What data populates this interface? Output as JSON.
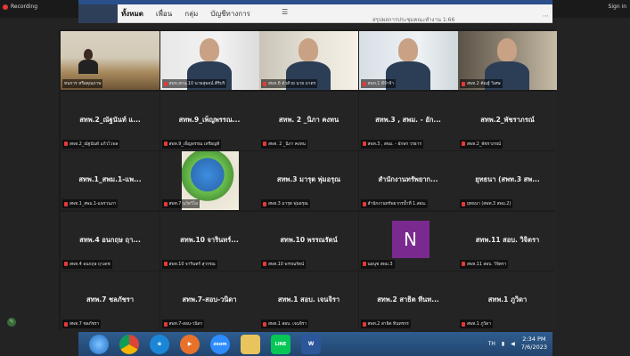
{
  "topbar": {
    "recording": "Recording",
    "signin": "Sign in"
  },
  "bg_window": {
    "tabs": [
      "ทั้งหมด",
      "เพื่อน",
      "กลุ่ม",
      "บัญชีทางการ"
    ],
    "sub_text": "สรุปผลการประชุมคณะทำงาน 1:66"
  },
  "gallery": {
    "tiles": [
      {
        "name": "",
        "label": "ทนการ หรือคุณภาพ",
        "video": "v1",
        "muted": false,
        "active": true
      },
      {
        "name": "",
        "label": "สพท.สกน.10 นายสุพจน์ ศิริบริ",
        "video": "v2",
        "muted": true
      },
      {
        "name": "",
        "label": "สพท.8 ตัวต้วย นาย มาตร",
        "video": "v3",
        "muted": true
      },
      {
        "name": "",
        "label": "สพท.1 ดีจ้าจ้า",
        "video": "v4",
        "muted": true
      },
      {
        "name": "",
        "label": "สพท.2 คัณฐ์ วิเศษ",
        "video": "v5",
        "muted": true
      },
      {
        "name": "สทพ.2_ณัฐนันท์ แ...",
        "label": "สพท.2_ณัฐนันท์ แก้วไวพล",
        "muted": true
      },
      {
        "name": "สทพ.9_เพ็ญพรรณ...",
        "label": "สพท.9_เพ็ญพรรณ เหรียญทิ",
        "muted": true
      },
      {
        "name": "สทพ. 2 _นิภา คงทน",
        "label": "สพท. 2 _นิภา คงทน",
        "muted": true
      },
      {
        "name": "สทพ.3 , สพม. - อัก...",
        "label": "สพท.3 , สพม. - อักษร วรธาร",
        "muted": true
      },
      {
        "name": "สทพ.2_พัชราภรณ์",
        "label": "สพท.2_พัชราภรณ์",
        "muted": true
      },
      {
        "name": "สทพ.1_สพม.1-แพ...",
        "label": "สพท.1_สพม.1-แพรวนภา",
        "muted": true
      },
      {
        "name": "",
        "label": "สพท.7 นวัตวิไล",
        "video": "globe",
        "muted": true
      },
      {
        "name": "สทพ.3 มารุต พุ่มอรุณ",
        "label": "สพท.3 มารุต พุ่มอรุณ",
        "muted": true
      },
      {
        "name": "สำนักงานทรัพยาก...",
        "label": "สำนักงานทรัพยากรน้ำที่ 1.สอน.",
        "muted": true
      },
      {
        "name": "ยุทธนา (สพท.3 สพ...",
        "label": "ยุทธนา (สพท.3 สพม.2)",
        "muted": true
      },
      {
        "name": "สทพ.4 อนกฤษ ฤา...",
        "label": "สพท.4 อนกฤษ ฤาเดช",
        "muted": true
      },
      {
        "name": "สทพ.10 จารินทร์...",
        "label": "สพท.10 จารินทร์ สุวรรณ",
        "muted": true
      },
      {
        "name": "สทพ.10 พรรณรัตน์",
        "label": "สพท.10 พรรณรัตน์",
        "muted": true
      },
      {
        "name": "",
        "label": "นอนุช สพม.3",
        "avatar": "N",
        "muted": true
      },
      {
        "name": "สทพ.11 สอบ. วิจิตรา",
        "label": "สพท.11 สอบ. วิจิตรา",
        "muted": true
      },
      {
        "name": "สทพ.7 ชลภัชรา",
        "label": "สพท.7 ชลภัชรา",
        "muted": true
      },
      {
        "name": "สทพ.7-สอบ-วนิดา",
        "label": "สพท.7-สอบ-วนิดา",
        "muted": true
      },
      {
        "name": "สทพ.1 สอบ. เจนจิรา",
        "label": "สพท.1 สอบ. เจนจิรา",
        "muted": true
      },
      {
        "name": "สทพ.2 สาธิต ทีนท...",
        "label": "สพท.2 สาธิต ทินทรกร",
        "muted": true
      },
      {
        "name": "สทพ.1 ภูวิดา",
        "label": "สพท.1 ภูวิดา",
        "muted": true
      }
    ]
  },
  "taskbar": {
    "apps": [
      {
        "icon": "windows-start-icon",
        "text": ""
      },
      {
        "icon": "chrome-icon",
        "text": ""
      },
      {
        "icon": "internet-explorer-icon",
        "text": "e"
      },
      {
        "icon": "media-player-icon",
        "text": "▶"
      },
      {
        "icon": "zoom-icon",
        "text": "zoom"
      },
      {
        "icon": "file-explorer-icon",
        "text": ""
      },
      {
        "icon": "line-icon",
        "text": "LINE"
      },
      {
        "icon": "word-icon",
        "text": "W"
      }
    ],
    "lang": "TH",
    "time": "2:34 PM",
    "date": "7/6/2023"
  }
}
